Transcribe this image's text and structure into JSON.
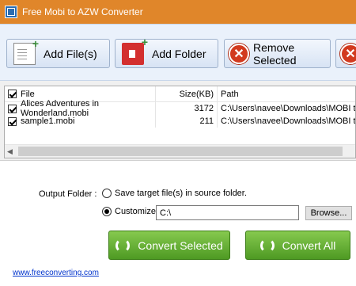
{
  "window": {
    "title": "Free Mobi to AZW Converter"
  },
  "toolbar": {
    "add_files": "Add File(s)",
    "add_folder": "Add Folder",
    "remove_selected": "Remove Selected"
  },
  "filelist": {
    "columns": {
      "file": "File",
      "size": "Size(KB)",
      "path": "Path"
    },
    "rows": [
      {
        "checked": true,
        "file": "Alices Adventures in Wonderland.mobi",
        "size": "3172",
        "path": "C:\\Users\\navee\\Downloads\\MOBI to..."
      },
      {
        "checked": true,
        "file": "sample1.mobi",
        "size": "211",
        "path": "C:\\Users\\navee\\Downloads\\MOBI to..."
      }
    ]
  },
  "output": {
    "label": "Output Folder :",
    "option_source": "Save target file(s) in source folder.",
    "option_customize": "Customize :",
    "selected": "customize",
    "path_value": "C:\\",
    "browse": "Browse..."
  },
  "actions": {
    "convert_selected": "Convert Selected",
    "convert_all": "Convert All"
  },
  "footer": {
    "link": "www.freeconverting.com"
  },
  "colors": {
    "titlebar": "#e0862a",
    "toolbar_bg": "#eaf1fb",
    "green_button": "#5fa830",
    "remove_icon": "#d23a1f",
    "link": "#0033cc"
  }
}
